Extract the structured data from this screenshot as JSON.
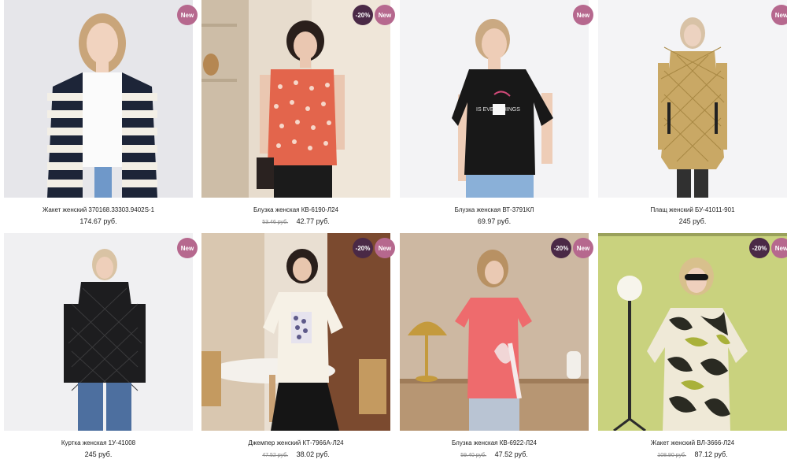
{
  "products": [
    {
      "title": "Жакет женский 370168.33303.9402S-1",
      "old_price": "",
      "price": "174.67 руб.",
      "badges": [
        "New"
      ]
    },
    {
      "title": "Блузка женская КВ-6190-Л24",
      "old_price": "53.46 руб.",
      "price": "42.77 руб.",
      "badges": [
        "-20%",
        "New"
      ]
    },
    {
      "title": "Блузка женская ВТ-3791КЛ",
      "old_price": "",
      "price": "69.97 руб.",
      "badges": [
        "New"
      ]
    },
    {
      "title": "Плащ женский БУ-41011-901",
      "old_price": "",
      "price": "245 руб.",
      "badges": [
        "New"
      ]
    },
    {
      "title": "Куртка женская 1У-41008",
      "old_price": "",
      "price": "245 руб.",
      "badges": [
        "New"
      ]
    },
    {
      "title": "Джемпер женский КТ-7966А-Л24",
      "old_price": "47.52 руб.",
      "price": "38.02 руб.",
      "badges": [
        "-20%",
        "New"
      ]
    },
    {
      "title": "Блузка женская КВ-6922-Л24",
      "old_price": "59.40 руб.",
      "price": "47.52 руб.",
      "badges": [
        "-20%",
        "New"
      ]
    },
    {
      "title": "Жакет женский ВЛ-3666-Л24",
      "old_price": "108.90 руб.",
      "price": "87.12 руб.",
      "badges": [
        "-20%",
        "New"
      ]
    }
  ],
  "colors": {
    "badge_new": "#b6688e",
    "badge_sale": "#4a2946"
  }
}
